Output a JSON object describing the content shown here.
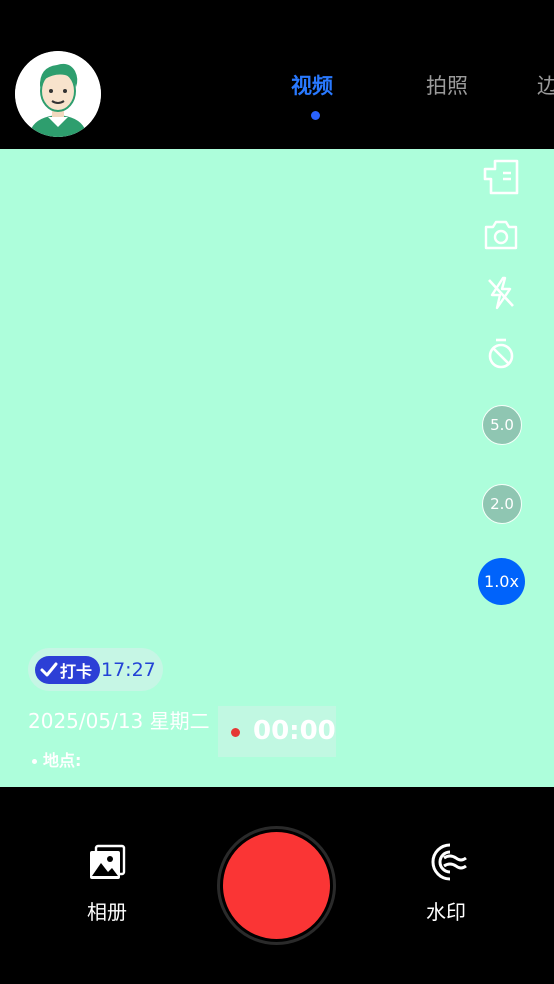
{
  "tabs": [
    {
      "label": "视频",
      "active": true
    },
    {
      "label": "拍照",
      "active": false
    },
    {
      "label": "边",
      "active": false
    }
  ],
  "side_tools": [
    "layout-icon",
    "camera-switch-icon",
    "flash-off-icon",
    "timer-icon"
  ],
  "zoom_levels": [
    "5.0",
    "2.0",
    "1.0x"
  ],
  "watermark": {
    "badge": "打卡",
    "time": "17:27",
    "date": "2025/05/13 星期二",
    "location_label": "地点:"
  },
  "recording": {
    "time": "00:00"
  },
  "bottom": {
    "album_label": "相册",
    "watermark_label": "水印"
  },
  "colors": {
    "viewfinder": "#adfedb",
    "active_tab": "#2979ff",
    "shutter": "#fa3535",
    "zoom_active": "#0063fb"
  }
}
